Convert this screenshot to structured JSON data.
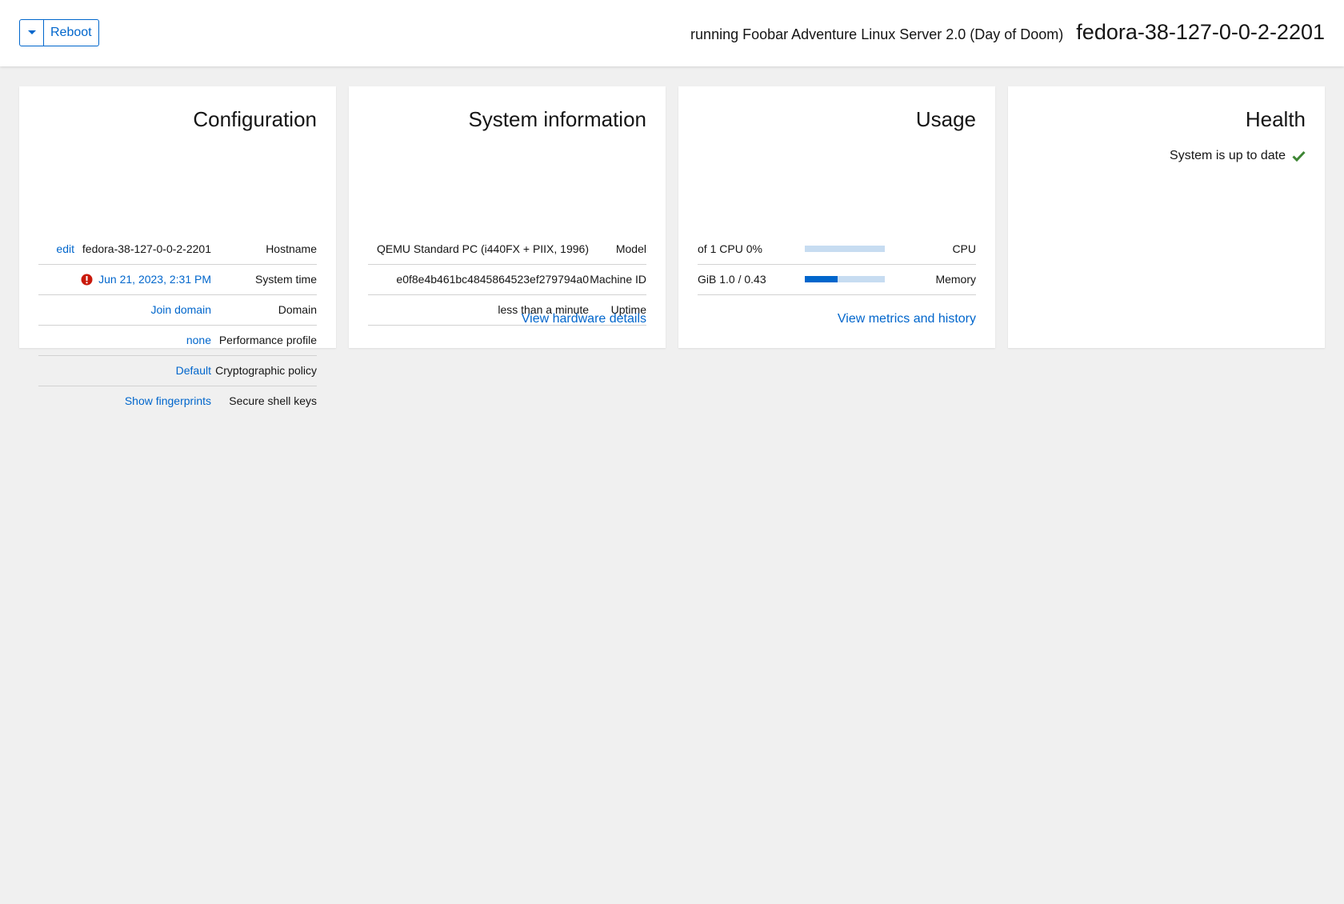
{
  "header": {
    "reboot_label": "Reboot",
    "os_text": "running Foobar Adventure Linux Server 2.0 (Day of Doom)",
    "hostname_title": "fedora-38-127-0-0-2-2201"
  },
  "configuration": {
    "title": "Configuration",
    "hostname": {
      "action": "edit",
      "value": "fedora-38-127-0-0-2-2201",
      "label": "Hostname"
    },
    "system_time": {
      "value": "Jun 21, 2023, 2:31 PM",
      "label": "System time"
    },
    "domain": {
      "value": "Join domain",
      "label": "Domain"
    },
    "performance_profile": {
      "value": "none",
      "label": "Performance profile"
    },
    "crypto_policy": {
      "value": "Default",
      "label": "Cryptographic policy"
    },
    "ssh_keys": {
      "value": "Show fingerprints",
      "label": "Secure shell keys"
    }
  },
  "system_information": {
    "title": "System information",
    "model": {
      "value": "QEMU Standard PC (i440FX + PIIX, 1996)",
      "label": "Model"
    },
    "machine_id": {
      "value": "e0f8e4b461bc4845864523ef279794a0",
      "label": "Machine ID"
    },
    "uptime": {
      "value": "less than a minute",
      "label": "Uptime"
    },
    "link": "View hardware details"
  },
  "usage": {
    "title": "Usage",
    "cpu": {
      "text": "of 1 CPU 0%",
      "label": "CPU",
      "fraction": 0.0
    },
    "memory": {
      "text": "GiB 1.0 / 0.43",
      "label": "Memory",
      "fraction": 0.41
    },
    "link": "View metrics and history"
  },
  "health": {
    "title": "Health",
    "status": "System is up to date"
  },
  "colors": {
    "accent": "#0066cc",
    "error": "#c9190b",
    "success": "#3e8635"
  }
}
